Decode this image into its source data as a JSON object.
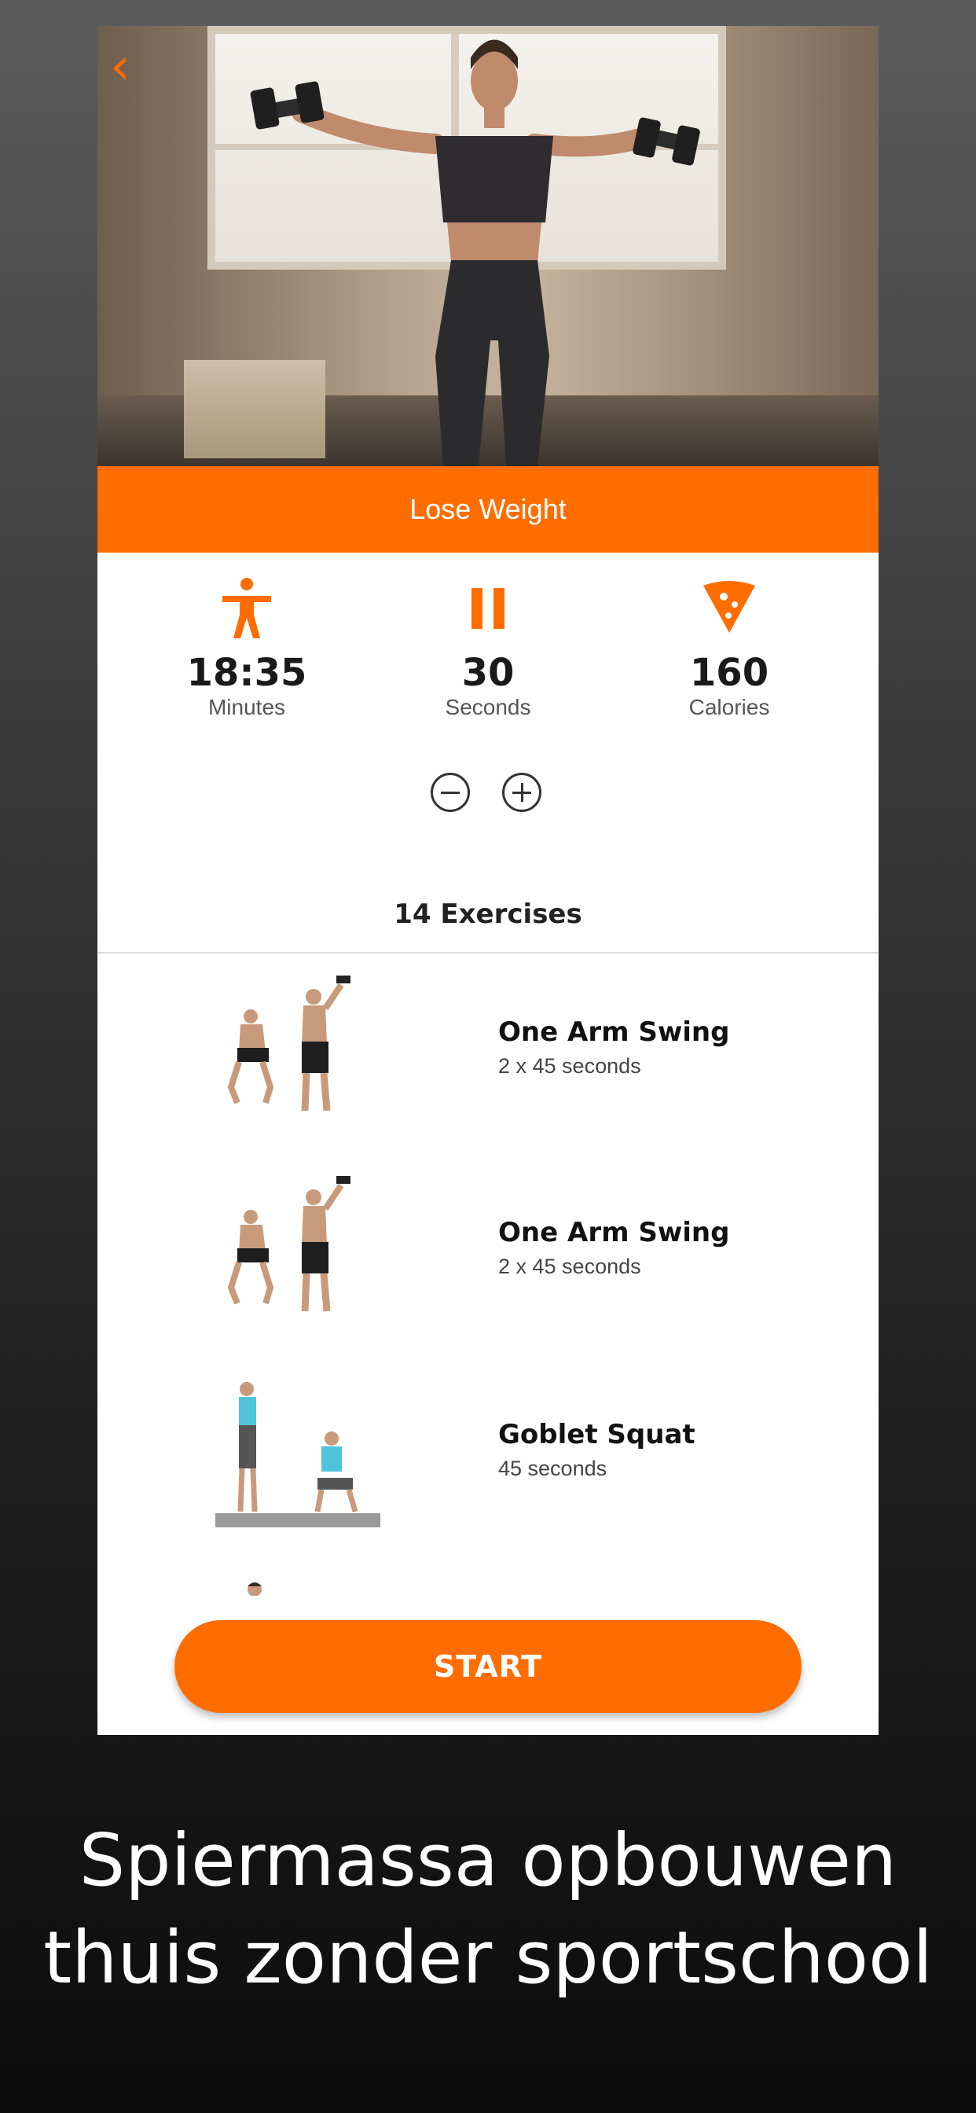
{
  "workout": {
    "title": "Lose Weight",
    "stats": [
      {
        "icon": "person-icon",
        "value": "18:35",
        "label": "Minutes"
      },
      {
        "icon": "pause-icon",
        "value": "30",
        "label": "Seconds"
      },
      {
        "icon": "pizza-slice-icon",
        "value": "160",
        "label": "Calories"
      }
    ],
    "exercises_count_label": "14 Exercises",
    "exercises": [
      {
        "name": "One Arm Swing",
        "duration": "2 x 45 seconds"
      },
      {
        "name": "One Arm Swing",
        "duration": "2 x 45 seconds"
      },
      {
        "name": "Goblet Squat",
        "duration": "45 seconds"
      }
    ],
    "start_label": "START"
  },
  "caption": {
    "line1": "Spiermassa opbouwen",
    "line2": "thuis zonder sportschool"
  },
  "colors": {
    "accent": "#ff6d00",
    "page_background": "#2a2a2a"
  }
}
